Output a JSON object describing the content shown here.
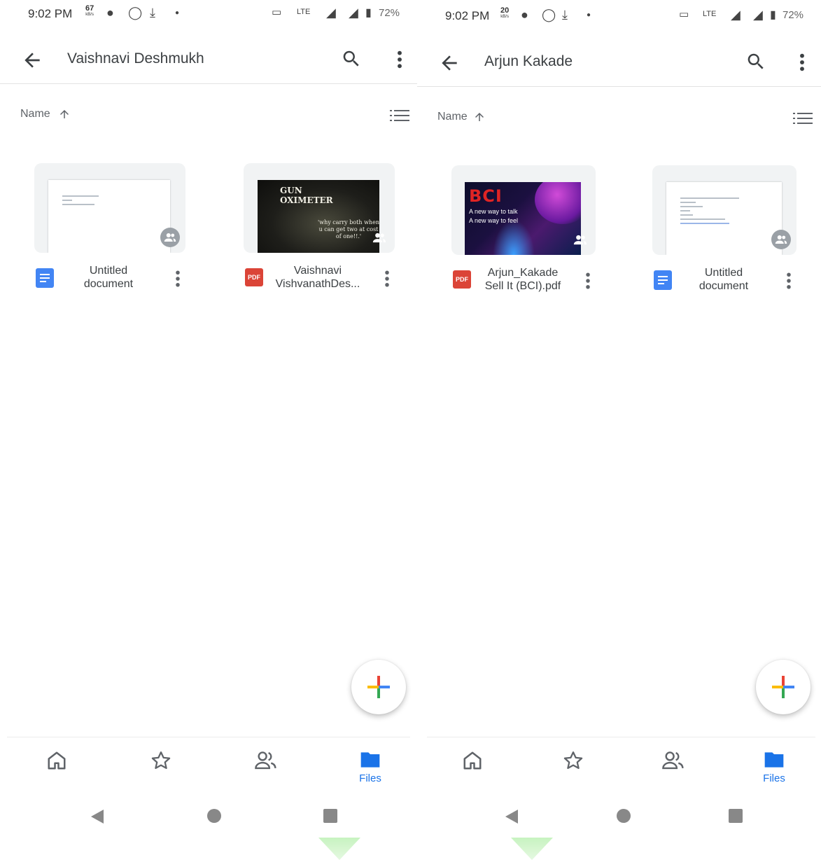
{
  "left": {
    "status": {
      "time": "9:02 PM",
      "speed_value": "67",
      "speed_unit": "kB/s",
      "battery": "72%"
    },
    "appbar": {
      "title": "Vaishnavi Deshmukh"
    },
    "sort": {
      "label": "Name"
    },
    "files": [
      {
        "type": "doc",
        "name_line1": "Untitled",
        "name_line2": "document"
      },
      {
        "type": "pdf",
        "icon_text": "PDF",
        "name_line1": "Vaishnavi",
        "name_line2": "VishvanathDes...",
        "thumb_title": "GUN\nOXIMETER",
        "thumb_caption": "'why carry both when u can get two at cost of one!!.'"
      }
    ],
    "nav": {
      "files_label": "Files"
    }
  },
  "right": {
    "status": {
      "time": "9:02 PM",
      "speed_value": "20",
      "speed_unit": "kB/s",
      "battery": "72%"
    },
    "appbar": {
      "title": "Arjun Kakade"
    },
    "sort": {
      "label": "Name"
    },
    "files": [
      {
        "type": "pdf",
        "icon_text": "PDF",
        "name_line1": "Arjun_Kakade",
        "name_line2": "Sell It (BCI).pdf",
        "thumb_logo": "BCI",
        "thumb_tag1": "A new way to talk",
        "thumb_tag2": "A new way to feel"
      },
      {
        "type": "doc",
        "name_line1": "Untitled",
        "name_line2": "document"
      }
    ],
    "nav": {
      "files_label": "Files"
    }
  },
  "colors": {
    "accent": "#1a73e8",
    "doc_blue": "#4285f4",
    "pdf_red": "#db4437",
    "icon_grey": "#5f6368"
  },
  "icons": [
    "back-arrow-icon",
    "search-icon",
    "more-vert-icon",
    "sort-arrow-up-icon",
    "list-view-icon",
    "shared-people-icon",
    "home-icon",
    "star-icon",
    "shared-icon",
    "folder-icon",
    "plus-icon"
  ]
}
